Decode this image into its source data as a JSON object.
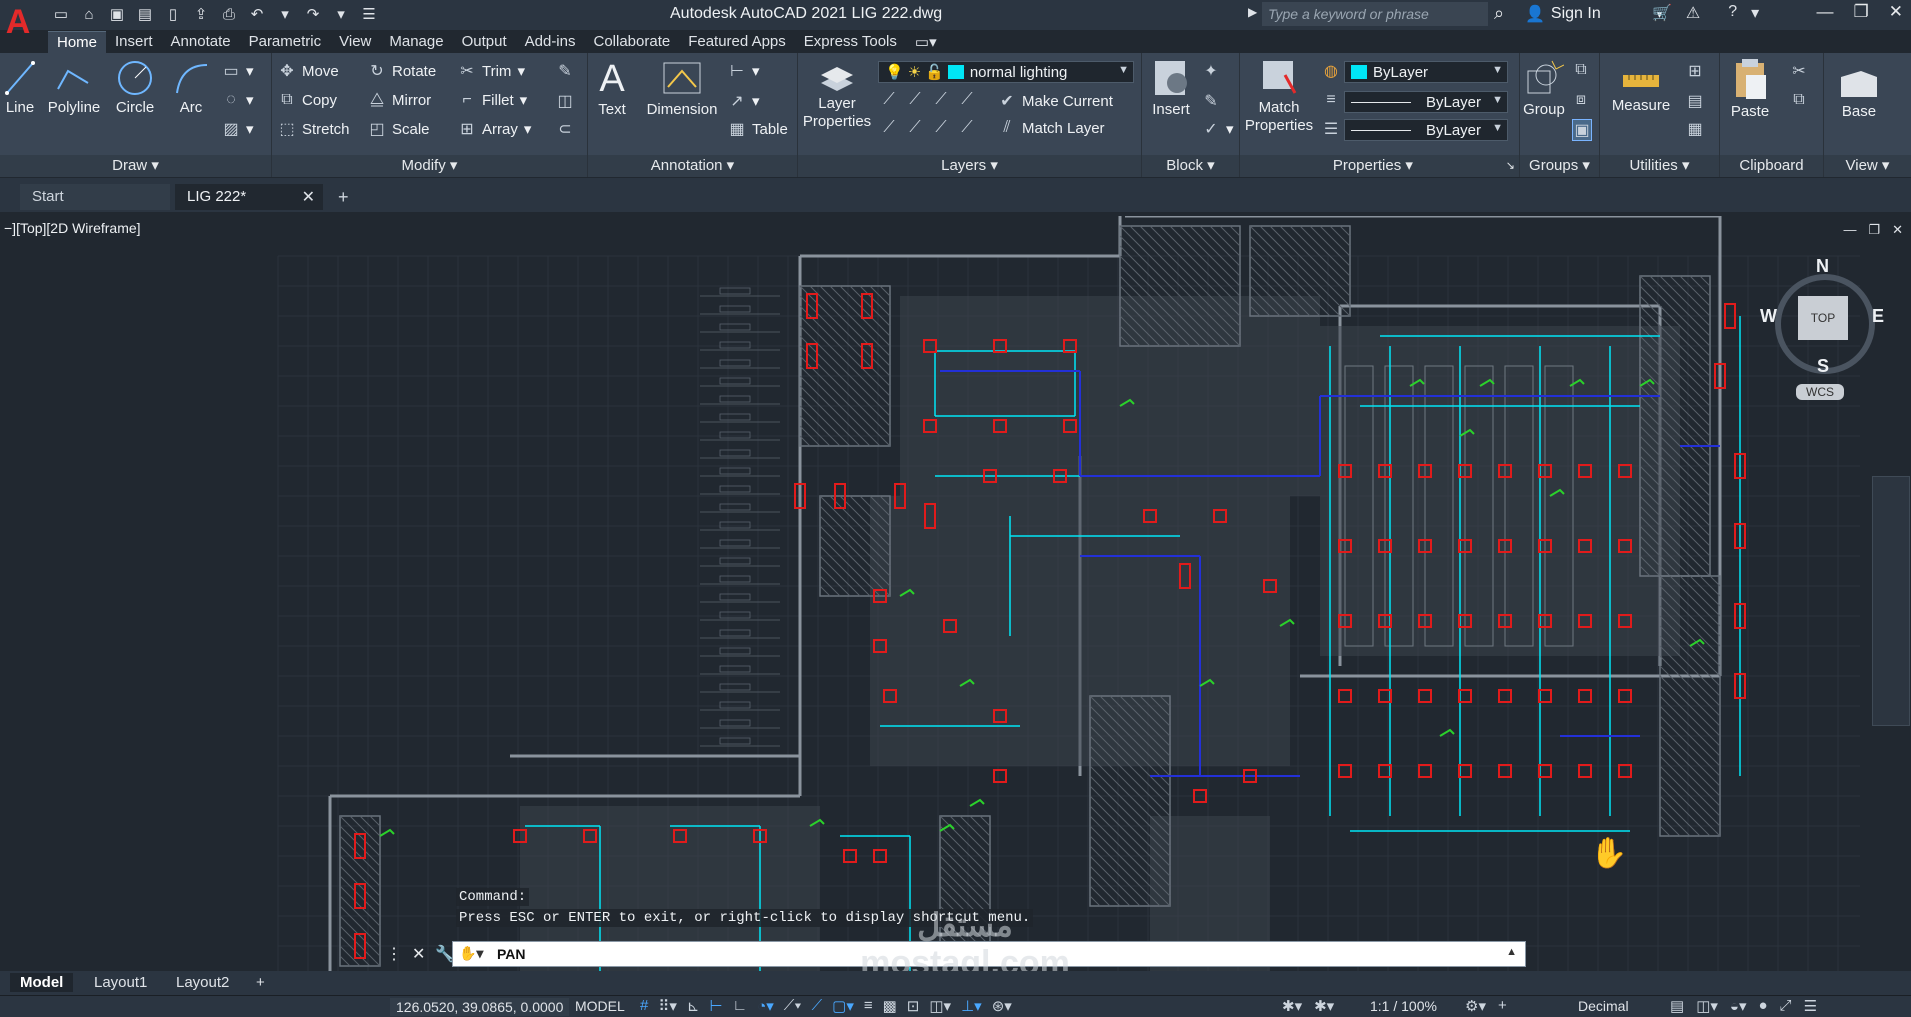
{
  "app": {
    "title": "Autodesk AutoCAD 2021    LIG 222.dwg",
    "logo": "A",
    "search_placeholder": "Type a keyword or phrase",
    "sign_in": "Sign In"
  },
  "ribbon_tabs": [
    "Home",
    "Insert",
    "Annotate",
    "Parametric",
    "View",
    "Manage",
    "Output",
    "Add-ins",
    "Collaborate",
    "Featured Apps",
    "Express Tools"
  ],
  "panels": {
    "draw": {
      "title": "Draw",
      "line": "Line",
      "polyline": "Polyline",
      "circle": "Circle",
      "arc": "Arc"
    },
    "modify": {
      "title": "Modify",
      "move": "Move",
      "rotate": "Rotate",
      "trim": "Trim",
      "copy": "Copy",
      "mirror": "Mirror",
      "fillet": "Fillet",
      "stretch": "Stretch",
      "scale": "Scale",
      "array": "Array"
    },
    "annotation": {
      "title": "Annotation",
      "text": "Text",
      "dimension": "Dimension",
      "table": "Table"
    },
    "layers": {
      "title": "Layers",
      "layer_properties": "Layer Properties",
      "current_layer": "normal lighting",
      "make_current": "Make Current",
      "match_layer": "Match Layer"
    },
    "block": {
      "title": "Block",
      "insert": "Insert"
    },
    "properties": {
      "title": "Properties",
      "match_properties": "Match Properties",
      "color": "ByLayer",
      "linetype": "ByLayer",
      "lineweight": "ByLayer"
    },
    "groups": {
      "title": "Groups",
      "group": "Group"
    },
    "utilities": {
      "title": "Utilities",
      "measure": "Measure"
    },
    "clipboard": {
      "title": "Clipboard",
      "paste": "Paste"
    },
    "view": {
      "title": "View",
      "base": "Base"
    }
  },
  "file_tabs": {
    "start": "Start",
    "doc": "LIG 222*"
  },
  "viewport": {
    "label": "−][Top][2D Wireframe]",
    "compass": {
      "n": "N",
      "s": "S",
      "e": "E",
      "w": "W",
      "top": "TOP",
      "wcs": "WCS"
    }
  },
  "command": {
    "history_1": "Command:",
    "history_2": "Press ESC or ENTER to exit, or right-click to display shortcut menu.",
    "current": "PAN"
  },
  "watermark": {
    "arabic": "مستقل",
    "latin": "mostaql.com"
  },
  "layout_tabs": [
    "Model",
    "Layout1",
    "Layout2"
  ],
  "status": {
    "coords": "126.0520, 39.0865, 0.0000",
    "model": "MODEL",
    "scale": "1:1 / 100%",
    "units": "Decimal"
  },
  "colors": {
    "accent": "#4aa8ff",
    "cyan_lines": "#00e6f6",
    "red_fixtures": "#e11b1b",
    "blue_lines": "#2330d8",
    "green_symbols": "#2bd12b"
  }
}
